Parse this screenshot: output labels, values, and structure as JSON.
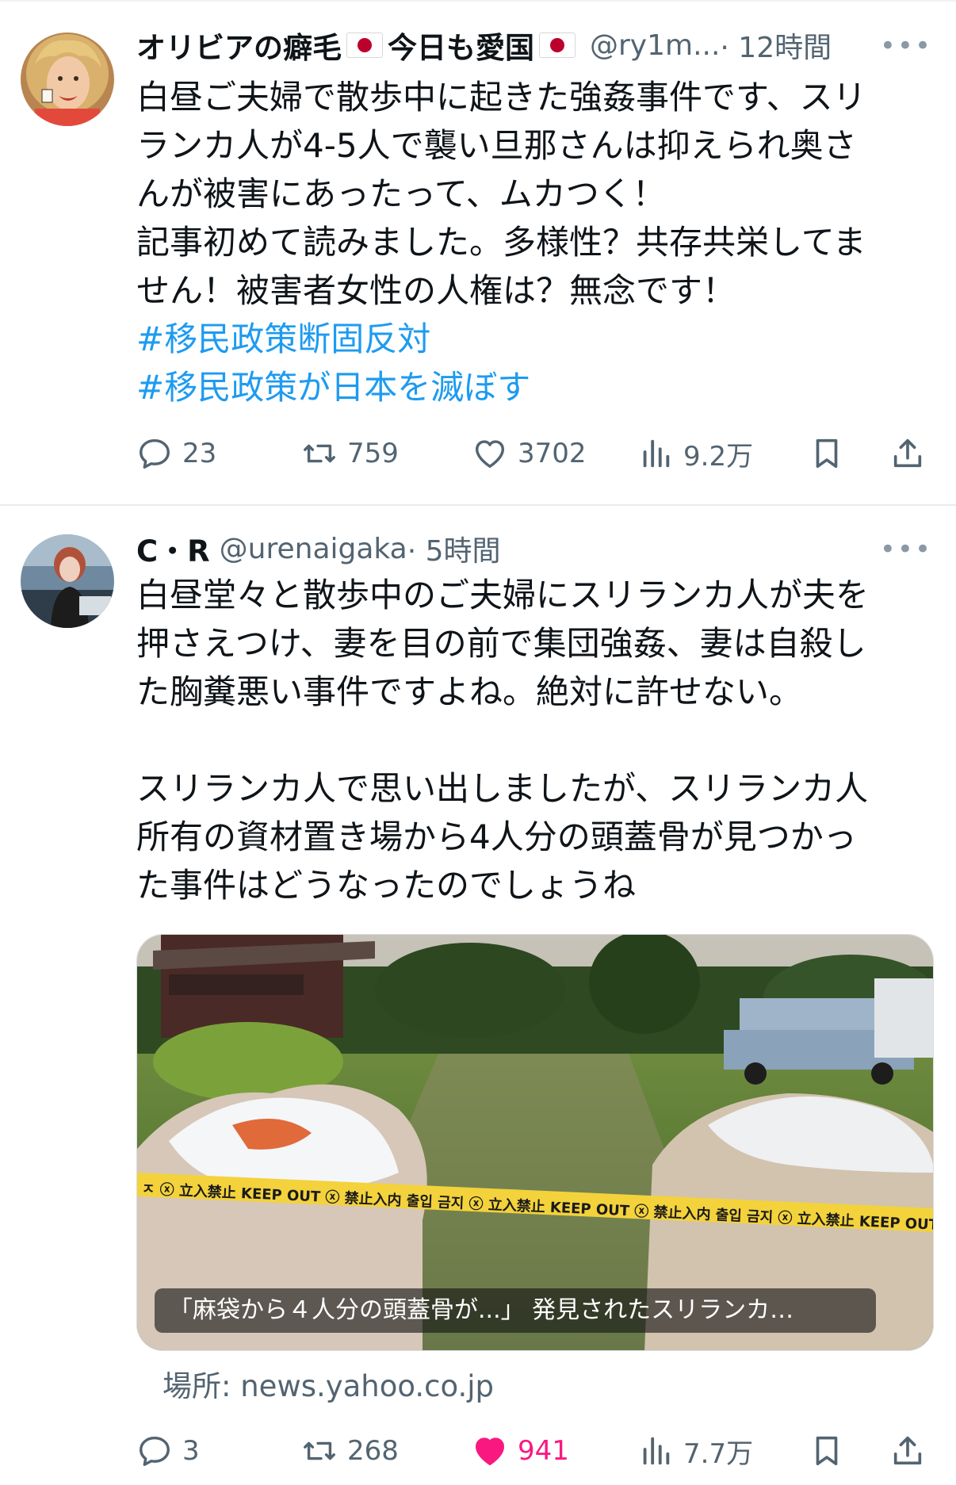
{
  "tweets": [
    {
      "display_name": "オリビアの癖毛",
      "display_name_suffix": "今日も愛国",
      "handle": "@ry1m...",
      "time": "· 12時間",
      "more": "•••",
      "lines": [
        "白昼ご夫婦で散歩中に起きた強姦事件です、スリ",
        "ランカ人が4-5人で襲い旦那さんは抑えられ奥さ",
        "んが被害にあったって、ムカつく！",
        "記事初めて読みました。多様性？共存共栄してま",
        "せん！被害者女性の人権は？無念です！"
      ],
      "hashtags": [
        "#移民政策断固反対",
        "#移民政策が日本を滅ぼす"
      ],
      "replies": "23",
      "retweets": "759",
      "likes": "3702",
      "views": "9.2万",
      "liked": false
    },
    {
      "display_name": "C・R",
      "handle": "@urenaigaka",
      "time": "· 5時間",
      "more": "•••",
      "lines": [
        "白昼堂々と散歩中のご夫婦にスリランカ人が夫を",
        "押さえつけ、妻を目の前で集団強姦、妻は自殺し",
        "た胸糞悪い事件ですよね。絶対に許せない。",
        "",
        "スリランカ人で思い出しましたが、スリランカ人",
        "所有の資材置き場から4人分の頭蓋骨が見つかっ",
        "た事件はどうなったのでしょうね"
      ],
      "card": {
        "caption": "「麻袋から４人分の頭蓋骨が...」 発見されたスリランカ…",
        "tape_text": "ㅈ ⓧ 立入禁止 KEEP OUT ⓧ 禁止入内 출입 금지 ⓧ 立入禁止 KEEP OUT ⓧ 禁止入内 출입 금지 ⓧ 立入禁止 KEEP OUT",
        "source": "場所: news.yahoo.co.jp"
      },
      "replies": "3",
      "retweets": "268",
      "likes": "941",
      "views": "7.7万",
      "liked": true
    }
  ],
  "colors": {
    "text": "#0f1419",
    "secondary": "#536471",
    "link": "#1d9bf0",
    "like_active": "#f91880",
    "divider": "#e6ecf0"
  },
  "icons": [
    "reply-icon",
    "retweet-icon",
    "like-icon",
    "views-icon",
    "bookmark-icon",
    "share-icon",
    "more-icon",
    "flag-japan-icon"
  ]
}
